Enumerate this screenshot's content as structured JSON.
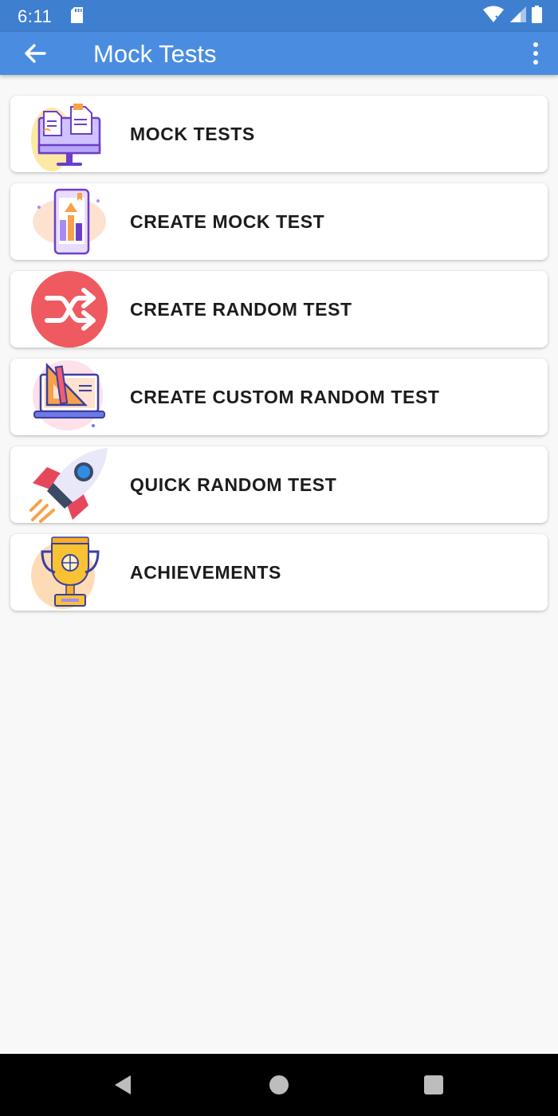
{
  "status_bar": {
    "time": "6:11",
    "icons": [
      "sd-card-icon",
      "wifi-icon",
      "signal-icon",
      "battery-icon"
    ]
  },
  "app_bar": {
    "title": "Mock Tests",
    "back_icon": "arrow-left-icon",
    "menu_icon": "more-vert-icon",
    "color": "#4a8de0"
  },
  "menu": {
    "items": [
      {
        "label": "MOCK TESTS",
        "icon": "computer-documents-icon"
      },
      {
        "label": "CREATE MOCK TEST",
        "icon": "phone-chart-icon"
      },
      {
        "label": "CREATE RANDOM TEST",
        "icon": "shuffle-icon"
      },
      {
        "label": "CREATE CUSTOM RANDOM TEST",
        "icon": "laptop-design-tools-icon"
      },
      {
        "label": "QUICK RANDOM TEST",
        "icon": "rocket-icon"
      },
      {
        "label": "ACHIEVEMENTS",
        "icon": "trophy-icon"
      }
    ]
  },
  "nav_bar": {
    "buttons": [
      "back-triangle-icon",
      "home-circle-icon",
      "recents-square-icon"
    ]
  }
}
